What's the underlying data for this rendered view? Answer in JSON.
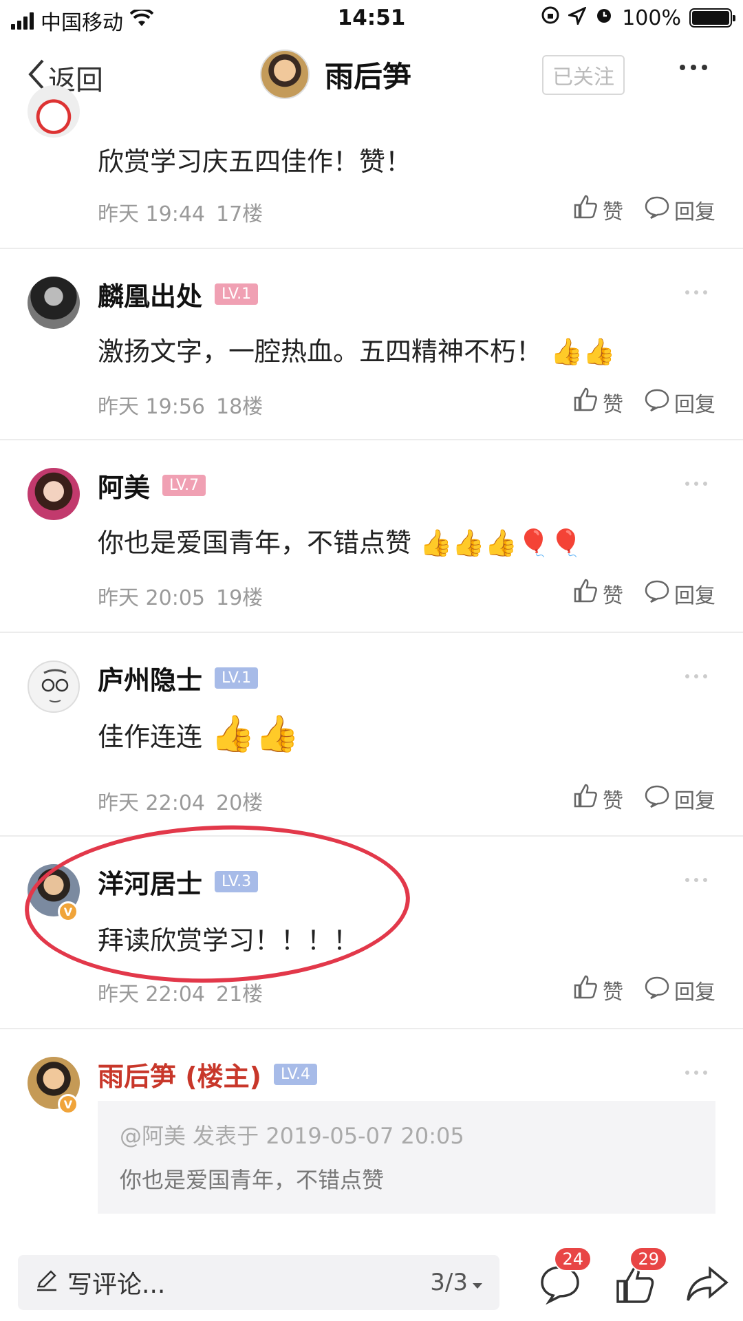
{
  "status_bar": {
    "carrier": "中国移动",
    "time": "14:51",
    "battery_text": "100%"
  },
  "nav": {
    "back_label": "返回",
    "title": "雨后笋",
    "follow_label": "已关注"
  },
  "comments": [
    {
      "text": "欣赏学习庆五四佳作！赞！",
      "time": "昨天 19:44",
      "floor": "17楼",
      "like_label": "赞",
      "reply_label": "回复"
    },
    {
      "author": "麟凰出处",
      "level": "LV.1",
      "text": "激扬文字，一腔热血。五四精神不朽！",
      "emoji": "👍👍",
      "time": "昨天 19:56",
      "floor": "18楼",
      "like_label": "赞",
      "reply_label": "回复"
    },
    {
      "author": "阿美",
      "level": "LV.7",
      "text": "你也是爱国青年，不错点赞",
      "emoji": "👍👍👍🎈🎈",
      "time": "昨天 20:05",
      "floor": "19楼",
      "like_label": "赞",
      "reply_label": "回复"
    },
    {
      "author": "庐州隐士",
      "level": "LV.1",
      "text": "佳作连连",
      "emoji": "👍👍",
      "time": "昨天 22:04",
      "floor": "20楼",
      "like_label": "赞",
      "reply_label": "回复"
    },
    {
      "author": "洋河居士",
      "level": "LV.3",
      "text": "拜读欣赏学习！！！！",
      "time": "昨天 22:04",
      "floor": "21楼",
      "like_label": "赞",
      "reply_label": "回复"
    },
    {
      "author": "雨后笋 (楼主)",
      "level": "LV.4",
      "quote_meta": "@阿美 发表于 2019-05-07 20:05",
      "quote_text": "你也是爱国青年，不错点赞"
    }
  ],
  "bottom_bar": {
    "input_placeholder": "写评论...",
    "page": "3/3",
    "comment_count": "24",
    "like_count": "29"
  }
}
